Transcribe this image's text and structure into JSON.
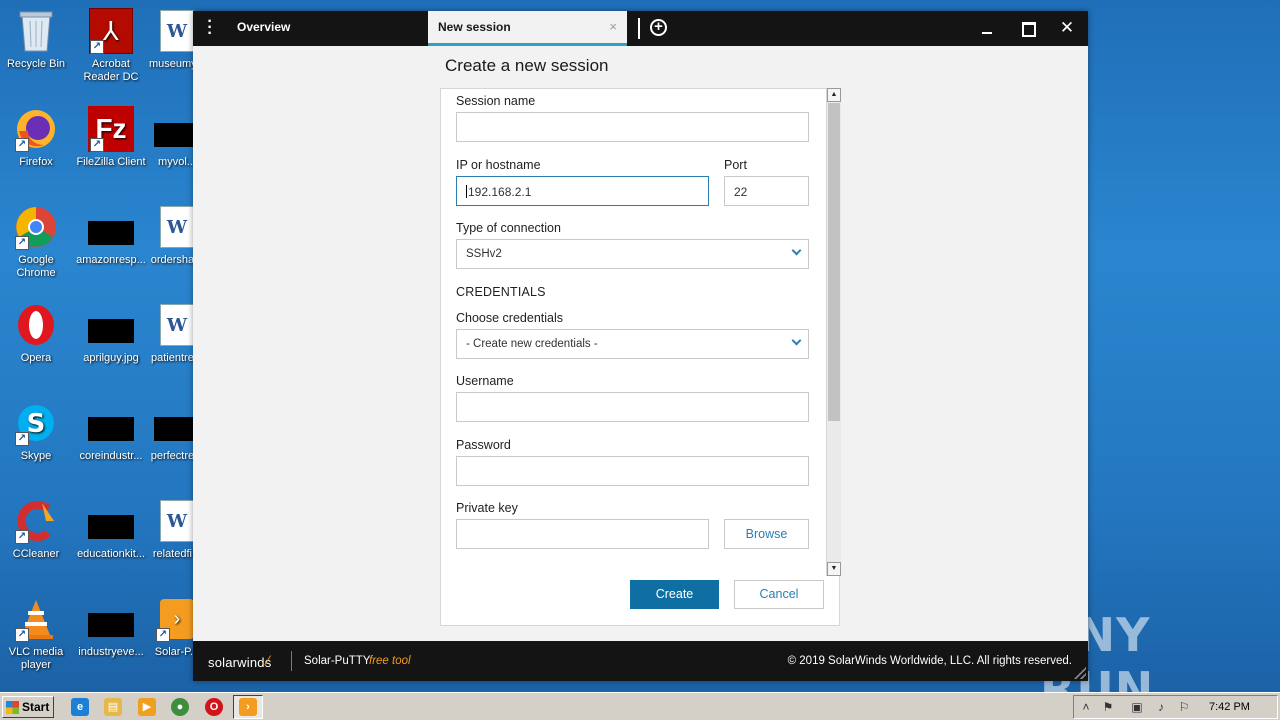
{
  "desktop": {
    "icons": [
      {
        "label": "Recycle Bin",
        "icon": "recycle-bin-icon"
      },
      {
        "label": "Acrobat Reader DC",
        "icon": "acrobat-icon"
      },
      {
        "label": "museumy...",
        "icon": "word-doc-icon"
      },
      {
        "label": "Firefox",
        "icon": "firefox-icon"
      },
      {
        "label": "FileZilla Client",
        "icon": "filezilla-icon"
      },
      {
        "label": "myvol...",
        "icon": "black-thumbnail-icon"
      },
      {
        "label": "Google Chrome",
        "icon": "chrome-icon"
      },
      {
        "label": "amazonresp...",
        "icon": "black-thumbnail-icon"
      },
      {
        "label": "ordersha...",
        "icon": "word-doc-icon"
      },
      {
        "label": "Opera",
        "icon": "opera-icon"
      },
      {
        "label": "aprilguy.jpg",
        "icon": "black-thumbnail-icon"
      },
      {
        "label": "patientre...",
        "icon": "word-doc-icon"
      },
      {
        "label": "Skype",
        "icon": "skype-icon"
      },
      {
        "label": "coreindustr...",
        "icon": "black-thumbnail-icon"
      },
      {
        "label": "perfectre...",
        "icon": "black-thumbnail-icon"
      },
      {
        "label": "CCleaner",
        "icon": "ccleaner-icon"
      },
      {
        "label": "educationkit...",
        "icon": "black-thumbnail-icon"
      },
      {
        "label": "relatedfi...",
        "icon": "word-doc-icon"
      },
      {
        "label": "VLC media player",
        "icon": "vlc-icon"
      },
      {
        "label": "industryeve...",
        "icon": "black-thumbnail-icon"
      },
      {
        "label": "Solar-P...",
        "icon": "solar-putty-icon"
      }
    ],
    "watermark": "ANY RUN"
  },
  "window": {
    "tabs": [
      {
        "label": "Overview",
        "active": false
      },
      {
        "label": "New session",
        "active": true,
        "close_glyph": "×"
      }
    ],
    "add_tab_glyph": "+",
    "controls": {
      "minimize": "minimize",
      "maximize": "maximize",
      "close": "✕"
    },
    "page_title": "Create a new session",
    "form": {
      "session_name": {
        "label": "Session name",
        "value": ""
      },
      "host": {
        "label": "IP or hostname",
        "value": "192.168.2.1"
      },
      "port": {
        "label": "Port",
        "value": "22"
      },
      "connection_type": {
        "label": "Type of connection",
        "value": "SSHv2"
      },
      "credentials_section": "CREDENTIALS",
      "choose_credentials": {
        "label": "Choose credentials",
        "value": "- Create new credentials -"
      },
      "username": {
        "label": "Username",
        "value": ""
      },
      "password": {
        "label": "Password",
        "value": ""
      },
      "private_key": {
        "label": "Private key",
        "value": "",
        "browse_label": "Browse"
      }
    },
    "actions": {
      "create": "Create",
      "cancel": "Cancel"
    },
    "footer": {
      "brand": "solarwinds",
      "product": "Solar-PuTTY",
      "product_tag": "free tool",
      "copyright": "© 2019 SolarWinds Worldwide, LLC. All rights reserved."
    },
    "colors": {
      "accent": "#0f6fa3",
      "brand_orange": "#f49c1c",
      "titlebar": "#141414",
      "tab_underline": "#2da0c6"
    }
  },
  "taskbar": {
    "start_label": "Start",
    "clock": "7:42 PM",
    "pinned": [
      "ie-icon",
      "explorer-icon",
      "media-player-icon",
      "chrome-icon",
      "opera-icon",
      "solar-putty-icon"
    ]
  }
}
